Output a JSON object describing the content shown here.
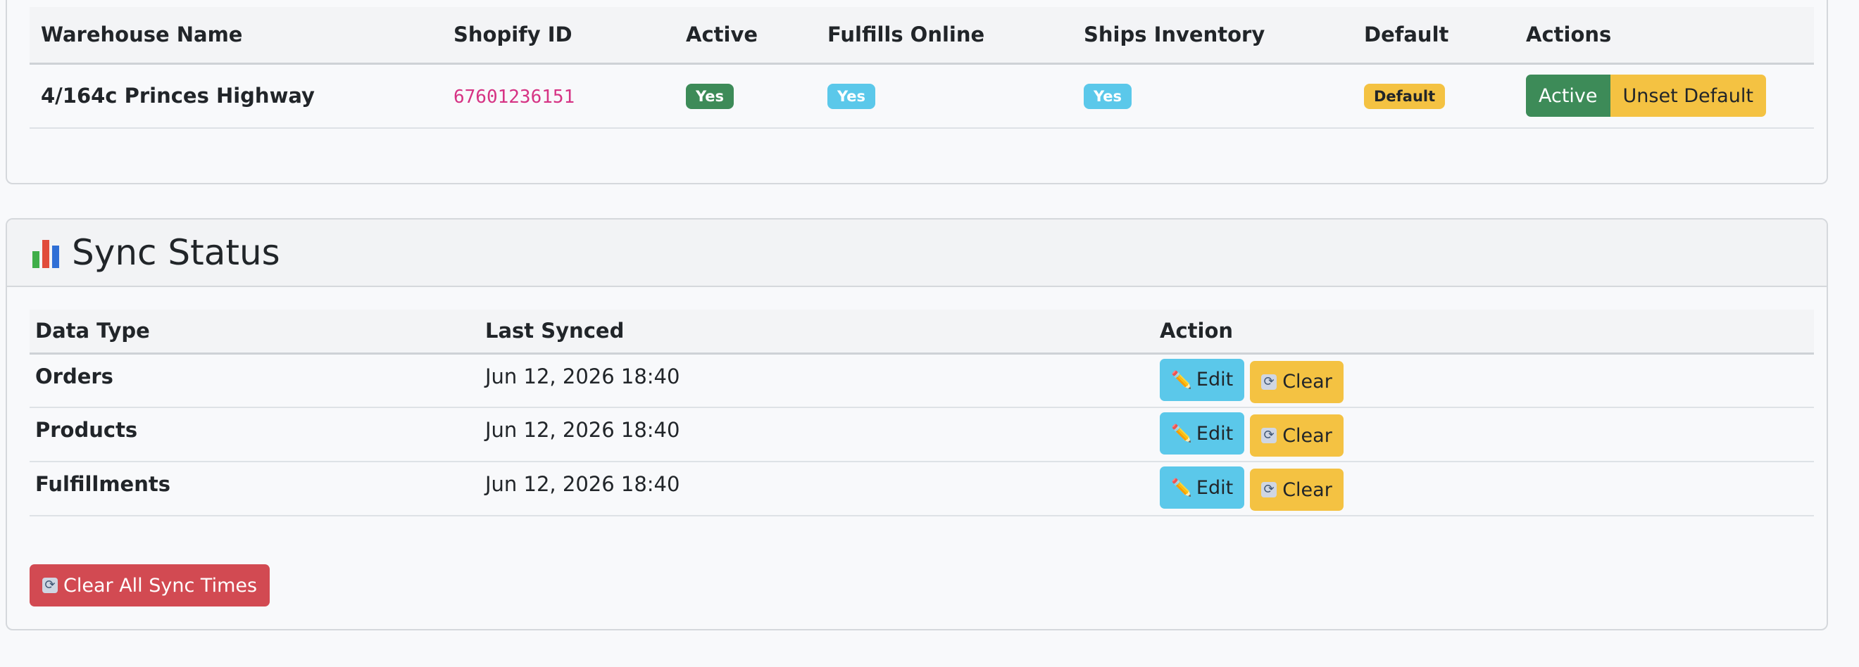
{
  "warehouse": {
    "headers": [
      "Warehouse Name",
      "Shopify ID",
      "Active",
      "Fulfills Online",
      "Ships Inventory",
      "Default",
      "Actions"
    ],
    "row": {
      "name": "4/164c Princes Highway",
      "shopify_id": "67601236151",
      "active": "Yes",
      "fulfills_online": "Yes",
      "ships_inventory": "Yes",
      "default": "Default",
      "action_active": "Active",
      "action_unset_default": "Unset Default"
    }
  },
  "sync": {
    "title": "Sync Status",
    "icon": "bar-chart-icon",
    "headers": [
      "Data Type",
      "Last Synced",
      "Action"
    ],
    "rows": [
      {
        "type": "Orders",
        "last_synced": "Jun 12, 2026 18:40"
      },
      {
        "type": "Products",
        "last_synced": "Jun 12, 2026 18:40"
      },
      {
        "type": "Fulfillments",
        "last_synced": "Jun 12, 2026 18:40"
      }
    ],
    "edit_label": "Edit",
    "clear_label": "Clear",
    "clear_all_label": "Clear All Sync Times"
  },
  "colors": {
    "success": "#3d8b58",
    "info": "#5bc8ea",
    "warning": "#f4c242",
    "danger": "#d24a52",
    "code": "#d63384"
  }
}
